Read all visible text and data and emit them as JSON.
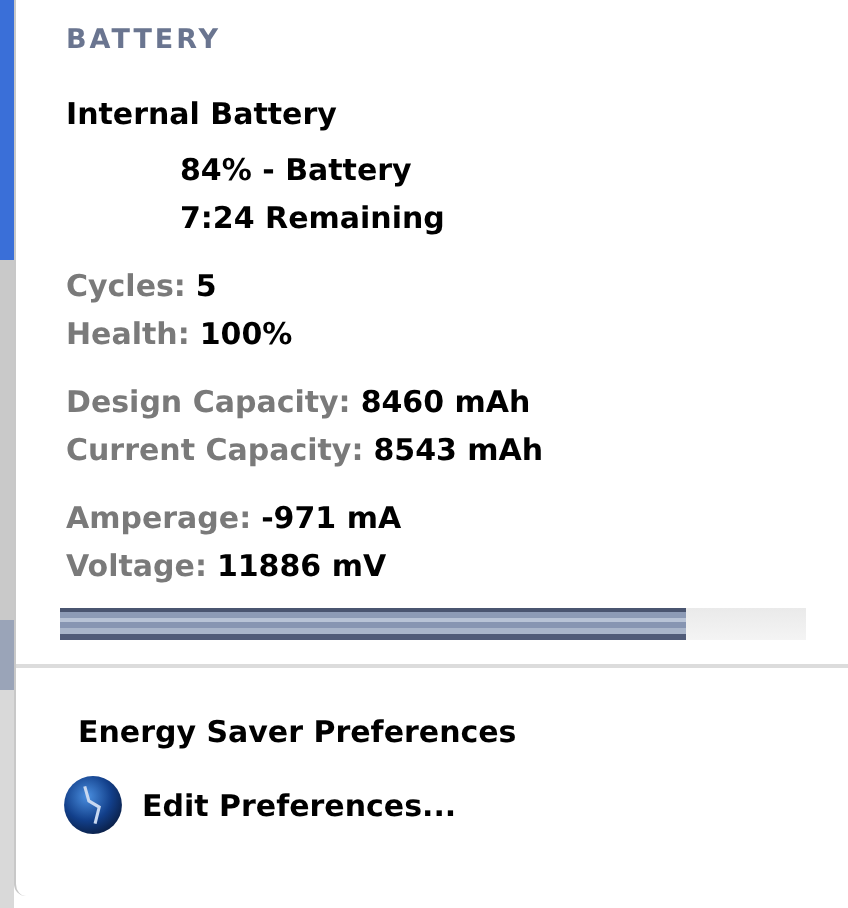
{
  "menu": {
    "header": "BATTERY",
    "battery_name": "Internal Battery",
    "status_lines": [
      "84% - Battery",
      "7:24 Remaining"
    ],
    "stat_groups": [
      [
        {
          "label": "Cycles:",
          "value": "5"
        },
        {
          "label": "Health:",
          "value": "100%"
        }
      ],
      [
        {
          "label": "Design Capacity:",
          "value": "8460 mAh"
        },
        {
          "label": "Current Capacity:",
          "value": "8543 mAh"
        }
      ],
      [
        {
          "label": "Amperage:",
          "value": "-971 mA"
        },
        {
          "label": "Voltage:",
          "value": "11886 mV"
        }
      ]
    ],
    "charge": {
      "level": 0.84
    },
    "section_title": "Energy Saver Preferences",
    "items": [
      {
        "label": "Edit Preferences..."
      }
    ]
  }
}
